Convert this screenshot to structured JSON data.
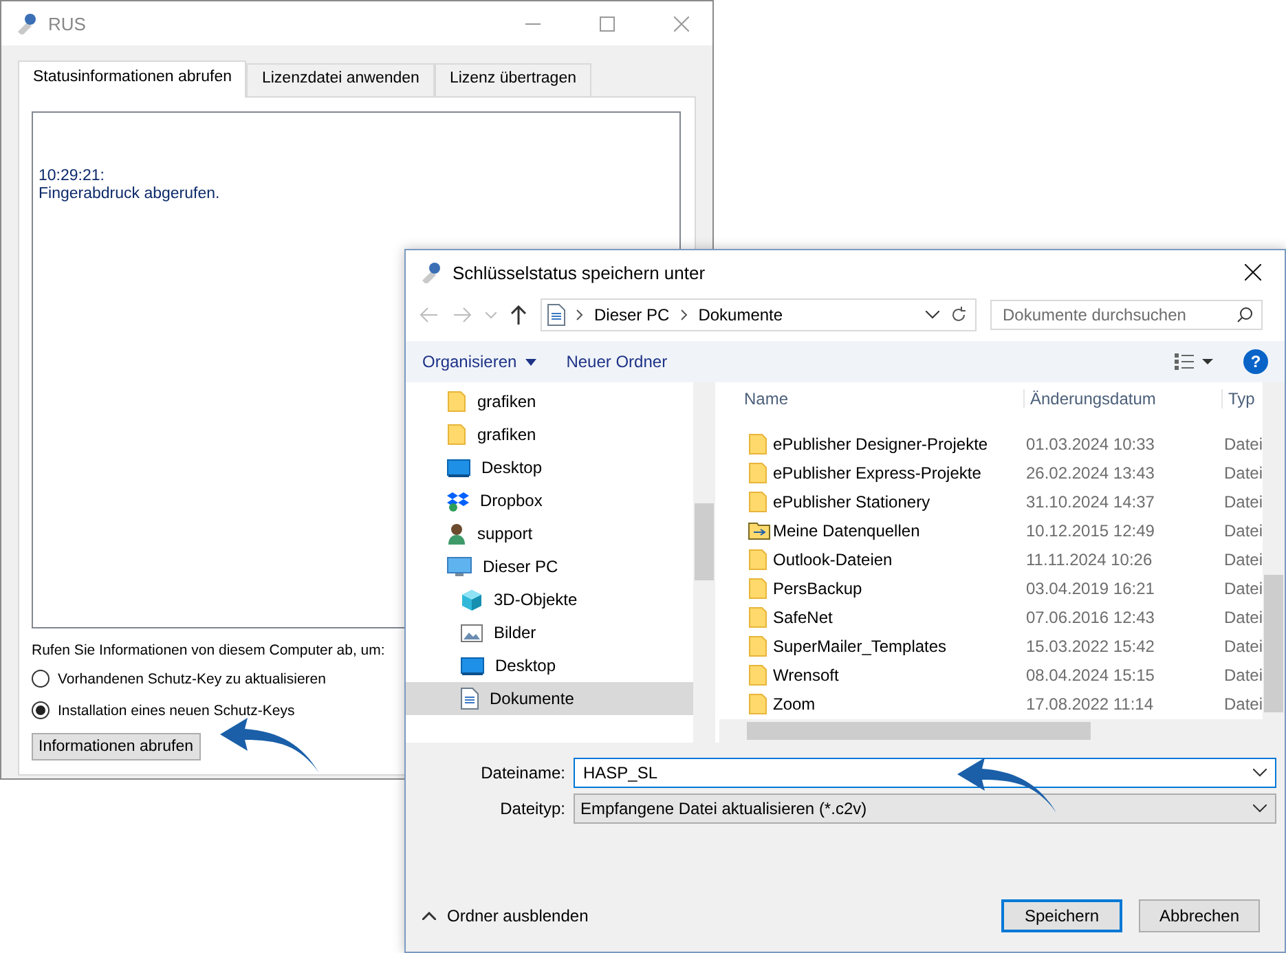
{
  "rus_window": {
    "title": "RUS",
    "tabs": [
      {
        "label": "Statusinformationen abrufen",
        "selected": true
      },
      {
        "label": "Lizenzdatei anwenden",
        "selected": false
      },
      {
        "label": "Lizenz übertragen",
        "selected": false
      }
    ],
    "log_lines": [
      "10:29:21:",
      "Fingerabdruck abgerufen."
    ],
    "prompt": "Rufen Sie Informationen von diesem Computer ab, um:",
    "options": [
      {
        "label": "Vorhandenen Schutz-Key zu aktualisieren",
        "selected": false
      },
      {
        "label": "Installation eines neuen Schutz-Keys",
        "selected": true
      }
    ],
    "button": "Informationen abrufen"
  },
  "save_dialog": {
    "title": "Schlüsselstatus speichern unter",
    "breadcrumb": [
      "Dieser PC",
      "Dokumente"
    ],
    "search": {
      "placeholder": "Dokumente durchsuchen"
    },
    "toolbar": [
      "Organisieren",
      "Neuer Ordner"
    ],
    "help": "?",
    "nav_items": [
      {
        "label": "grafiken",
        "kind": "folder",
        "selected": false
      },
      {
        "label": "grafiken",
        "kind": "folder",
        "selected": false
      },
      {
        "label": "Desktop",
        "kind": "desktop",
        "selected": false
      },
      {
        "label": "Dropbox",
        "kind": "dropbox",
        "selected": false
      },
      {
        "label": "support",
        "kind": "user",
        "selected": false
      },
      {
        "label": "Dieser PC",
        "kind": "pc",
        "selected": false,
        "children": [
          {
            "label": "3D-Objekte",
            "kind": "cube",
            "selected": false
          },
          {
            "label": "Bilder",
            "kind": "pictures",
            "selected": false
          },
          {
            "label": "Desktop",
            "kind": "desktop",
            "selected": false
          },
          {
            "label": "Dokumente",
            "kind": "documents",
            "selected": true
          }
        ]
      }
    ],
    "columns": [
      "Name",
      "Änderungsdatum",
      "Typ"
    ],
    "rows": [
      {
        "name": "ePublisher Designer-Projekte",
        "date": "01.03.2024 10:33",
        "type": "Datei",
        "kind": "folder"
      },
      {
        "name": "ePublisher Express-Projekte",
        "date": "26.02.2024 13:43",
        "type": "Datei",
        "kind": "folder"
      },
      {
        "name": "ePublisher Stationery",
        "date": "31.10.2024 14:37",
        "type": "Datei",
        "kind": "folder"
      },
      {
        "name": "Meine Datenquellen",
        "date": "10.12.2015 12:49",
        "type": "Datei",
        "kind": "datasource"
      },
      {
        "name": "Outlook-Dateien",
        "date": "11.11.2024 10:26",
        "type": "Datei",
        "kind": "folder"
      },
      {
        "name": "PersBackup",
        "date": "03.04.2019 16:21",
        "type": "Datei",
        "kind": "folder"
      },
      {
        "name": "SafeNet",
        "date": "07.06.2016 12:43",
        "type": "Datei",
        "kind": "folder"
      },
      {
        "name": "SuperMailer_Templates",
        "date": "15.03.2022 15:42",
        "type": "Datei",
        "kind": "folder"
      },
      {
        "name": "Wrensoft",
        "date": "08.04.2024 15:15",
        "type": "Datei",
        "kind": "folder"
      },
      {
        "name": "Zoom",
        "date": "17.08.2022 11:14",
        "type": "Datei",
        "kind": "folder"
      }
    ],
    "filename": {
      "label": "Dateiname:",
      "value": "HASP_SL"
    },
    "filetype": {
      "label": "Dateityp:",
      "value": "Empfangene Datei aktualisieren (*.c2v)"
    },
    "hide_folders": "Ordner ausblenden",
    "buttons": [
      "Speichern",
      "Abbrechen"
    ]
  }
}
